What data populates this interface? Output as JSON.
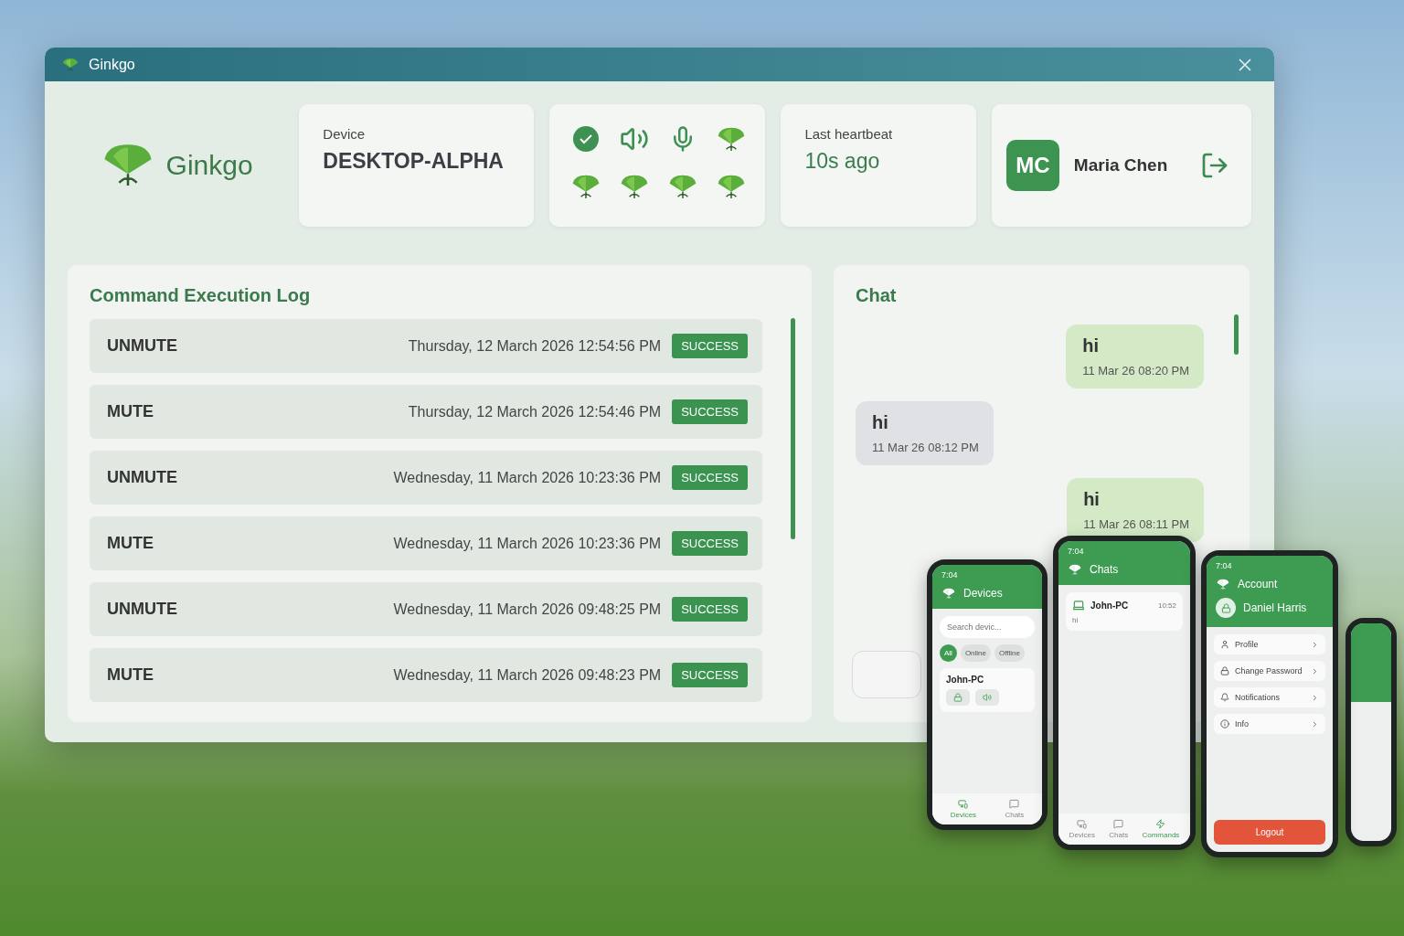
{
  "window": {
    "title": "Ginkgo"
  },
  "brand": {
    "name": "Ginkgo"
  },
  "device": {
    "label": "Device",
    "name": "DESKTOP-ALPHA"
  },
  "status_icons": [
    {
      "kind": "check"
    },
    {
      "kind": "speaker"
    },
    {
      "kind": "mic"
    },
    {
      "kind": "leaf"
    },
    {
      "kind": "leaf"
    },
    {
      "kind": "leaf"
    },
    {
      "kind": "leaf"
    },
    {
      "kind": "leaf"
    }
  ],
  "heartbeat": {
    "label": "Last heartbeat",
    "value": "10s ago"
  },
  "user": {
    "initials": "MC",
    "name": "Maria Chen"
  },
  "log": {
    "title": "Command Execution Log",
    "rows": [
      {
        "command": "UNMUTE",
        "time": "Thursday, 12 March 2026 12:54:56 PM",
        "status": "SUCCESS"
      },
      {
        "command": "MUTE",
        "time": "Thursday, 12 March 2026 12:54:46 PM",
        "status": "SUCCESS"
      },
      {
        "command": "UNMUTE",
        "time": "Wednesday, 11 March 2026 10:23:36 PM",
        "status": "SUCCESS"
      },
      {
        "command": "MUTE",
        "time": "Wednesday, 11 March 2026 10:23:36 PM",
        "status": "SUCCESS"
      },
      {
        "command": "UNMUTE",
        "time": "Wednesday, 11 March 2026 09:48:25 PM",
        "status": "SUCCESS"
      },
      {
        "command": "MUTE",
        "time": "Wednesday, 11 March 2026 09:48:23 PM",
        "status": "SUCCESS"
      }
    ]
  },
  "chat": {
    "title": "Chat",
    "messages": [
      {
        "kind": "sent",
        "text": "hi",
        "time": "11 Mar 26 08:20 PM"
      },
      {
        "kind": "received",
        "text": "hi",
        "time": "11 Mar 26 08:12 PM"
      },
      {
        "kind": "sent",
        "text": "hi",
        "time": "11 Mar 26 08:11 PM"
      }
    ]
  },
  "phones": [
    {
      "kind": "devices",
      "clock": "7:04",
      "title": "Devices",
      "search": {
        "placeholder": "Search devic..."
      },
      "filters": [
        {
          "label": "All",
          "selected": true
        },
        {
          "label": "Online",
          "selected": false
        },
        {
          "label": "Offline",
          "selected": false
        }
      ],
      "device": "John-PC",
      "nav": [
        {
          "label": "Devices",
          "selected": true
        },
        {
          "label": "Chats",
          "selected": false
        }
      ]
    },
    {
      "kind": "chats",
      "clock": "7:04",
      "title": "Chats",
      "chat": {
        "name": "John-PC",
        "preview": "hi",
        "time": "10:52"
      },
      "nav": [
        {
          "label": "Devices",
          "selected": false
        },
        {
          "label": "Chats",
          "selected": false
        },
        {
          "label": "Commands",
          "selected": true
        }
      ]
    },
    {
      "kind": "account",
      "clock": "7:04",
      "title": "Account",
      "user": "Daniel Harris",
      "items": [
        "Profile",
        "Change Password",
        "Notifications",
        "Info"
      ],
      "logout": "Logout"
    }
  ]
}
